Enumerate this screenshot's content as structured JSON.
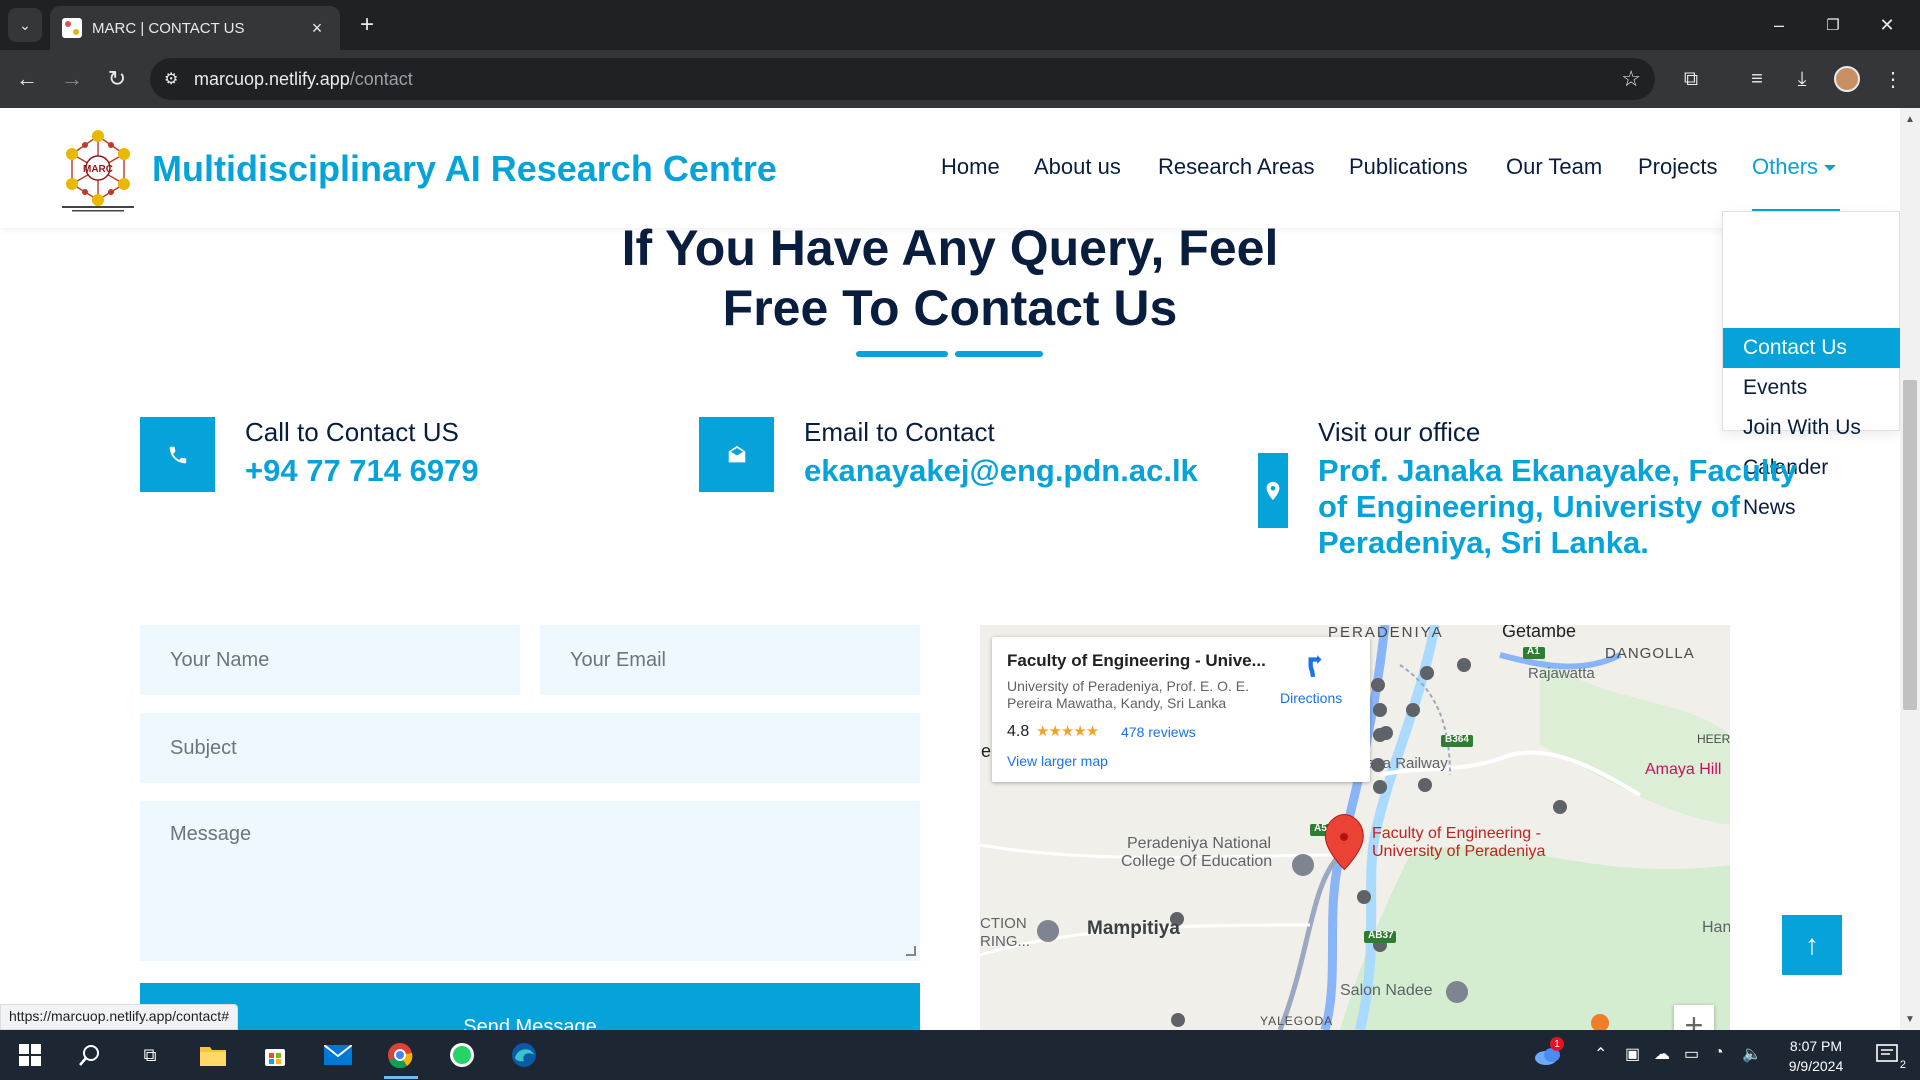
{
  "browser": {
    "tab_title": "MARC | CONTACT US",
    "url_host": "marcuop.netlify.app",
    "url_path": "/contact",
    "status_url": "https://marcuop.netlify.app/contact#"
  },
  "site": {
    "brand": "Multidisciplinary AI Research Centre",
    "logo_text": "MARC",
    "nav": {
      "home": "Home",
      "about": "About us",
      "research": "Research Areas",
      "publications": "Publications",
      "team": "Our Team",
      "projects": "Projects",
      "others": "Others"
    },
    "dropdown": [
      "Contact Us",
      "Events",
      "Join With Us",
      "Calander",
      "News"
    ]
  },
  "contact": {
    "heading_line1": "If You Have Any Query, Feel",
    "heading_line2": "Free To Contact Us",
    "call_label": "Call to Contact US",
    "call_value": "+94 77 714 6979",
    "email_label": "Email to Contact",
    "email_value": "ekanayakej@eng.pdn.ac.lk",
    "office_label": "Visit our office",
    "office_line1": "Prof. Janaka Ekanayake, Faculty",
    "office_line2": "of Engineering, Univeristy of",
    "office_line3": "Peradeniya, Sri Lanka."
  },
  "form": {
    "name_placeholder": "Your Name",
    "email_placeholder": "Your Email",
    "subject_placeholder": "Subject",
    "message_placeholder": "Message",
    "send_label": "Send Message"
  },
  "map": {
    "place_title": "Faculty of Engineering - Unive...",
    "address_line1": "University of Peradeniya, Prof. E. O. E.",
    "address_line2": "Pereira Mawatha, Kandy, Sri Lanka",
    "rating": "4.8",
    "stars": "★★★★★",
    "reviews": "478 reviews",
    "view_larger": "View larger map",
    "directions": "Directions",
    "labels": {
      "peradeniya": "PERADENIYA",
      "getambe": "Getambe",
      "dangolla": "DANGOLLA",
      "rajawatta": "Rajawatta",
      "railway": "ana Railway",
      "heer": "HEER",
      "amaya": "Amaya Hill",
      "college1": "Peradeniya National",
      "college2": "College Of Education",
      "faculty1": "Faculty of Engineering -",
      "faculty2": "University of Peradeniya",
      "action1": "CTION",
      "action2": "RING...",
      "mampitiya": "Mampitiya",
      "han": "Han",
      "salon": "Salon Nadee",
      "yalegoda": "YALEGODA",
      "e": "e",
      "a1": "A1",
      "a5": "A5",
      "b364": "B364",
      "ab37": "AB37"
    }
  },
  "taskbar": {
    "time": "8:07 PM",
    "date": "9/9/2024",
    "weather_badge": "1",
    "notif_count": "2"
  },
  "colors": {
    "accent": "#06a3da",
    "dark": "#091e3e",
    "field_bg": "#eef9ff"
  }
}
